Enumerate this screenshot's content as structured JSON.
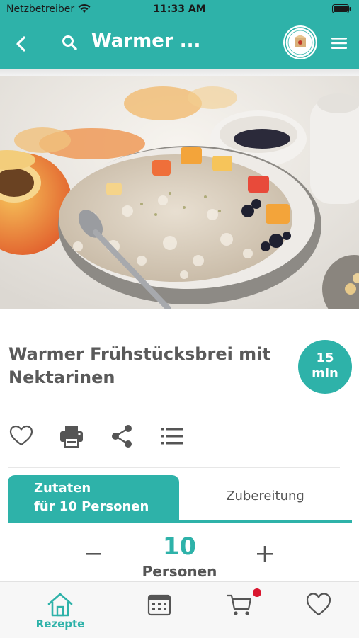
{
  "status_bar": {
    "carrier": "Netzbetreiber",
    "time": "11:33 AM"
  },
  "nav": {
    "title": "Warmer ...",
    "icons": [
      "back-arrow-icon",
      "search-icon",
      "brand-logo",
      "hamburger-menu-icon"
    ]
  },
  "recipe": {
    "title": "Warmer Frühstücksbrei mit Nektarinen",
    "time_value": "15",
    "time_unit": "min"
  },
  "actions": [
    "heart-icon",
    "print-icon",
    "share-icon",
    "list-icon"
  ],
  "tabs": {
    "ingredients_line1": "Zutaten",
    "ingredients_line2": "für 10 Personen",
    "preparation": "Zubereitung"
  },
  "servings": {
    "value": "10",
    "unit": "Personen",
    "minus": "−",
    "plus": "+"
  },
  "tabbar": {
    "items": [
      {
        "label": "Rezepte",
        "icon": "home-icon",
        "active": true
      },
      {
        "label": "",
        "icon": "calendar-icon"
      },
      {
        "label": "",
        "icon": "cart-icon",
        "badge": true
      },
      {
        "label": "",
        "icon": "heart-icon"
      }
    ]
  },
  "colors": {
    "accent": "#2eb2a9",
    "badge": "#d9162f",
    "text": "#555555"
  }
}
